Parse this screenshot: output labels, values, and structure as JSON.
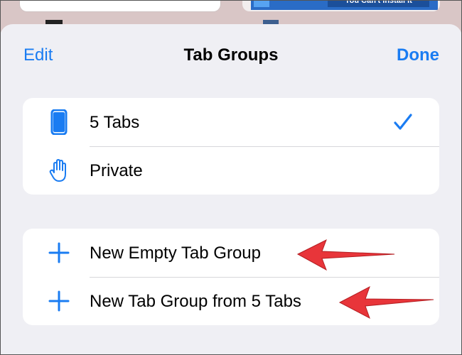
{
  "background": {
    "right_thumbnail_banner_text": "You Can't Install It"
  },
  "nav": {
    "edit_label": "Edit",
    "title": "Tab Groups",
    "done_label": "Done"
  },
  "tab_groups": [
    {
      "label": "5 Tabs",
      "icon": "phone-icon",
      "selected": true
    },
    {
      "label": "Private",
      "icon": "hand-icon",
      "selected": false
    }
  ],
  "actions": [
    {
      "label": "New Empty Tab Group",
      "icon": "plus-icon"
    },
    {
      "label": "New Tab Group from 5 Tabs",
      "icon": "plus-icon"
    }
  ],
  "annotations": {
    "arrow_color": "#e8353a",
    "accent_color": "#1a7cf2"
  }
}
